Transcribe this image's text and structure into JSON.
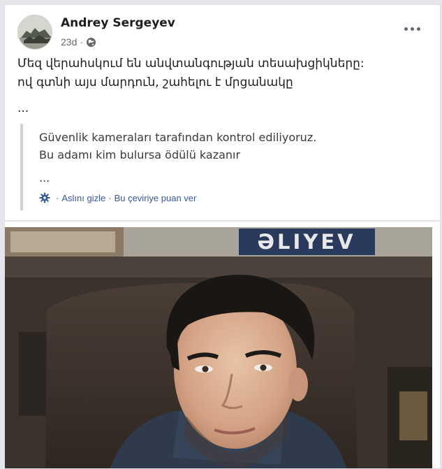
{
  "post": {
    "author": "Andrey Sergeyev",
    "time": "23d",
    "privacy_icon": "globe-icon",
    "more_icon": "more-horizontal-icon",
    "text_lines": [
      "Մեզ վերահսկում են անվտանգության տեսախցիկները:",
      "ով գտնի այս մարդուն, շահելու է մրցանակը",
      "..."
    ]
  },
  "translation": {
    "lines": [
      "Güvenlik kameraları tarafından kontrol ediliyoruz.",
      "Bu adamı kim bulursa ödülü kazanır",
      "..."
    ],
    "settings_icon": "gear-icon",
    "hide_original": "Aslını gizle",
    "rate_translation": "Bu çeviriye puan ver",
    "separator": "·"
  },
  "photo": {
    "sign_text": "ƏLIYEV"
  },
  "colors": {
    "link": "#385898",
    "meta": "#65676b",
    "quote_border": "#d0d2d6"
  }
}
